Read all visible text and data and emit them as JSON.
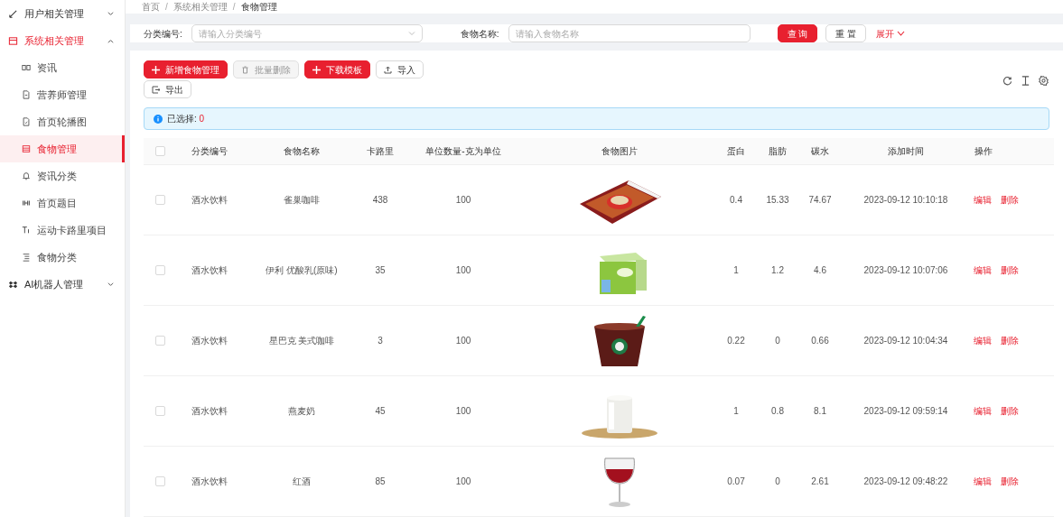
{
  "sidebar": {
    "items": [
      {
        "label": "用户相关管理",
        "expanded": false,
        "selected": false
      },
      {
        "label": "系统相关管理",
        "expanded": true,
        "selected": true,
        "children": [
          {
            "label": "资讯",
            "selected": false
          },
          {
            "label": "营养师管理",
            "selected": false
          },
          {
            "label": "首页轮播图",
            "selected": false
          },
          {
            "label": "食物管理",
            "selected": true
          },
          {
            "label": "资讯分类",
            "selected": false
          },
          {
            "label": "首页题目",
            "selected": false
          },
          {
            "label": "运动卡路里项目",
            "selected": false
          },
          {
            "label": "食物分类",
            "selected": false
          }
        ]
      },
      {
        "label": "AI机器人管理",
        "expanded": false,
        "selected": false
      }
    ]
  },
  "breadcrumb": {
    "separator": "/",
    "items": [
      "首页",
      "系统相关管理",
      "食物管理"
    ]
  },
  "search": {
    "fields": [
      {
        "kind": "select",
        "label": "分类编号:",
        "placeholder": "请输入分类编号"
      },
      {
        "kind": "input",
        "label": "食物名称:",
        "placeholder": "请输入食物名称"
      }
    ],
    "buttons": [
      {
        "kind": "primary",
        "label": "查 询"
      },
      {
        "kind": "default",
        "label": "重 置"
      }
    ],
    "expand_link": "展开"
  },
  "toolbar": {
    "buttons": [
      {
        "kind": "primary",
        "label": "新增食物管理",
        "disabled": false
      },
      {
        "kind": "default",
        "label": "批量删除",
        "disabled": true
      },
      {
        "kind": "primary",
        "label": "下载模板",
        "disabled": false
      },
      {
        "kind": "default",
        "label": "导入",
        "disabled": false
      },
      {
        "kind": "default",
        "label": "导出",
        "disabled": false
      }
    ]
  },
  "selection": {
    "label": "已选择:",
    "count": "0"
  },
  "table": {
    "select_all_checked": false,
    "columns": [
      "分类编号",
      "食物名称",
      "卡路里",
      "单位数量-克为单位",
      "食物图片",
      "蛋白",
      "脂肪",
      "碳水",
      "添加时间",
      "操作"
    ],
    "rows": [
      {
        "checked": false,
        "category": "酒水饮料",
        "name": "雀巢咖啡",
        "calories": "438",
        "unit": "100",
        "image": {
          "kind": "picture"
        },
        "protein": "0.4",
        "fat": "15.33",
        "carbs": "74.67",
        "added": "2023-09-12 10:10:18",
        "actions": [
          "编辑",
          "删除"
        ]
      },
      {
        "checked": false,
        "category": "酒水饮料",
        "name": "伊利 优酸乳(原味)",
        "calories": "35",
        "unit": "100",
        "image": {
          "kind": "picture"
        },
        "protein": "1",
        "fat": "1.2",
        "carbs": "4.6",
        "added": "2023-09-12 10:07:06",
        "actions": [
          "编辑",
          "删除"
        ]
      },
      {
        "checked": false,
        "category": "酒水饮料",
        "name": "星巴克 美式咖啡",
        "calories": "3",
        "unit": "100",
        "image": {
          "kind": "picture"
        },
        "protein": "0.22",
        "fat": "0",
        "carbs": "0.66",
        "added": "2023-09-12 10:04:34",
        "actions": [
          "编辑",
          "删除"
        ]
      },
      {
        "checked": false,
        "category": "酒水饮料",
        "name": "燕麦奶",
        "calories": "45",
        "unit": "100",
        "image": {
          "kind": "picture"
        },
        "protein": "1",
        "fat": "0.8",
        "carbs": "8.1",
        "added": "2023-09-12 09:59:14",
        "actions": [
          "编辑",
          "删除"
        ]
      },
      {
        "checked": false,
        "category": "酒水饮料",
        "name": "红酒",
        "calories": "85",
        "unit": "100",
        "image": {
          "kind": "picture"
        },
        "protein": "0.07",
        "fat": "0",
        "carbs": "2.61",
        "added": "2023-09-12 09:48:22",
        "actions": [
          "编辑",
          "删除"
        ]
      }
    ]
  }
}
